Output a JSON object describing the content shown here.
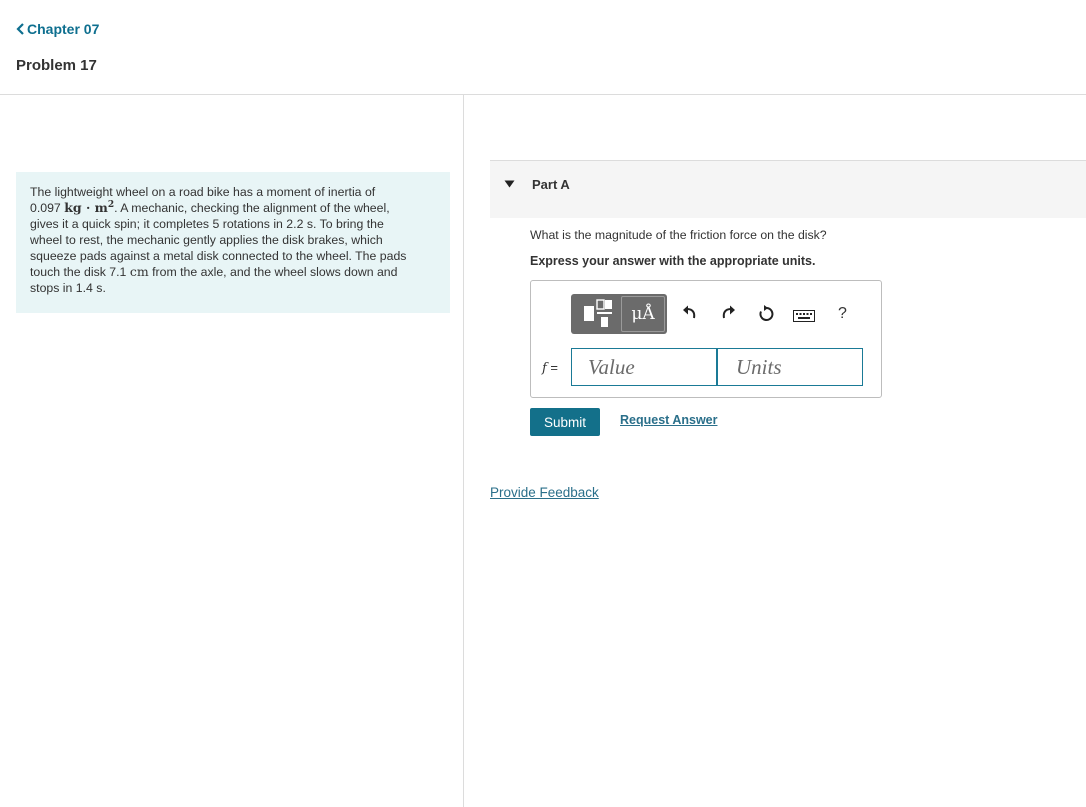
{
  "nav": {
    "back_label": "Chapter 07",
    "back_icon": "chevron-left-icon",
    "problem_title": "Problem 17"
  },
  "problem": {
    "t1": "The lightweight wheel on a road bike has a moment of inertia of",
    "t2": "0.097 ",
    "u1a": "kg · m",
    "u1b": "2",
    "t3": ". A mechanic, checking the alignment of the wheel,",
    "t4": "gives it a quick spin; it completes 5 rotations in 2.2 s. To bring the",
    "t5": "wheel to rest, the mechanic gently applies the disk brakes, which",
    "t6": "squeeze pads against a metal disk connected to the wheel. The pads",
    "t7": "touch the disk 7.1 ",
    "u2": "cm",
    "t8": " from the axle, and the wheel slows down and",
    "t9": "stops in 1.4 s."
  },
  "part": {
    "title": "Part A",
    "toggle_icon": "triangle-down-icon",
    "question": "What is the magnitude of the friction force on the disk?",
    "instruction": "Express your answer with the appropriate units."
  },
  "toolbar": {
    "units_button": "μÅ",
    "icons": [
      "templates-icon",
      "undo-icon",
      "redo-icon",
      "reset-icon",
      "keyboard-icon",
      "help-icon"
    ],
    "help": "?"
  },
  "answer": {
    "variable": "f",
    "equals": " =",
    "value_placeholder": "Value",
    "units_placeholder": "Units"
  },
  "actions": {
    "submit": "Submit",
    "request_answer": "Request Answer",
    "feedback": "Provide Feedback"
  },
  "colors": {
    "accent": "#13708a",
    "link": "#0e6f8f",
    "problem_bg": "#e8f5f6"
  }
}
